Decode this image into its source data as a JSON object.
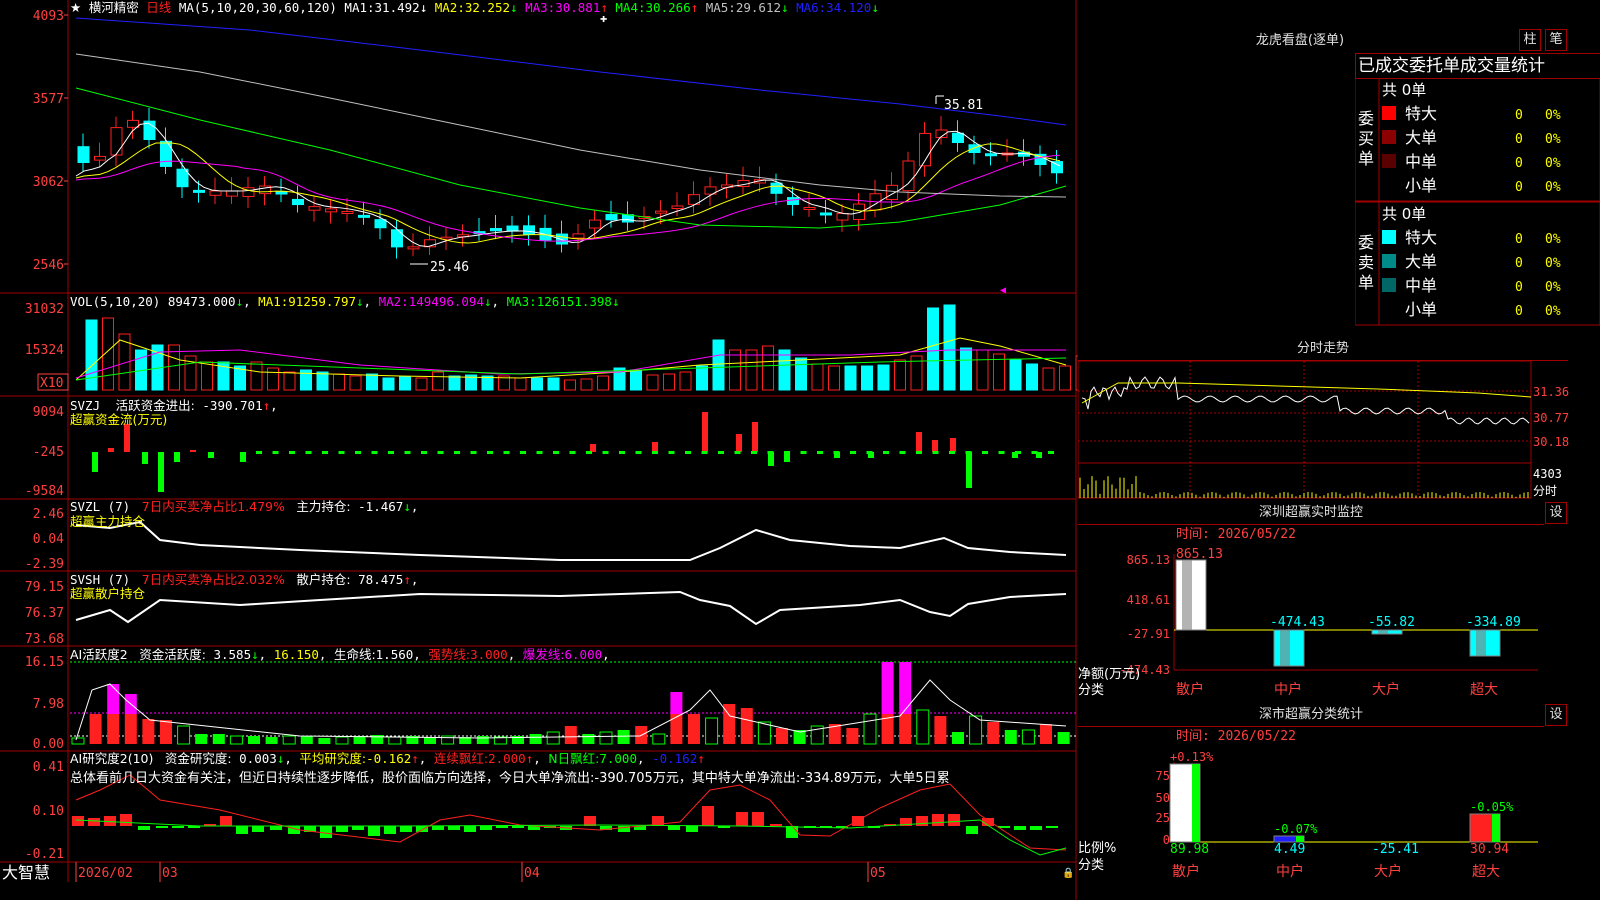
{
  "app_name": "大智慧",
  "stock": {
    "name": "横河精密",
    "period": "日线"
  },
  "colors": {
    "up": "#ff2020",
    "down": "#00ffff",
    "ma1": "#ffffff",
    "ma2": "#ffff00",
    "ma3": "#ff00ff",
    "ma4": "#00ff00",
    "ma5": "#c0c0c0",
    "ma6": "#2020ff",
    "grid": "#a00000"
  },
  "candle": {
    "ma_label": "MA(5,10,20,30,60,120)",
    "ma": [
      {
        "name": "MA1:",
        "value": "31.492",
        "arrow": "↓"
      },
      {
        "name": "MA2:",
        "value": "32.252",
        "arrow": "↓"
      },
      {
        "name": "MA3:",
        "value": "30.881",
        "arrow": "↑"
      },
      {
        "name": "MA4:",
        "value": "30.266",
        "arrow": "↑"
      },
      {
        "name": "MA5:",
        "value": "29.612",
        "arrow": "↓"
      },
      {
        "name": "MA6:",
        "value": "34.120",
        "arrow": "↓"
      }
    ],
    "y_ticks": [
      "4093",
      "3577",
      "3062",
      "2546"
    ],
    "high_mark": "35.81",
    "low_mark": "25.46"
  },
  "vol": {
    "label": "VOL(5,10,20)",
    "value": "89473.000",
    "ma": [
      {
        "name": "MA1:",
        "value": "91259.797",
        "arrow": "↓"
      },
      {
        "name": "MA2:",
        "value": "149496.094",
        "arrow": "↓"
      },
      {
        "name": "MA3:",
        "value": "126151.398",
        "arrow": "↓"
      }
    ],
    "y_ticks": [
      "31032",
      "15324"
    ],
    "unit": "X10"
  },
  "svzj": {
    "label": "SVZJ",
    "desc": "活跃资金进出:",
    "value": "-390.701",
    "arrow": "↑",
    "subtitle": "超赢资金流(万元)",
    "y_ticks": [
      "9094",
      "-245",
      "-9584"
    ]
  },
  "svzl": {
    "label": "SVZL (7)",
    "desc": "7日内买卖净占比1.479%",
    "name2": "主力持仓:",
    "value": "-1.467",
    "arrow": "↓",
    "subtitle": "超赢主力持仓",
    "y_ticks": [
      "2.46",
      "0.04",
      "-2.39"
    ]
  },
  "svsh": {
    "label": "SVSH (7)",
    "desc": "7日内买卖净占比2.032%",
    "name2": "散户持仓:",
    "value": "78.475",
    "arrow": "↑",
    "subtitle": "超赢散户持仓",
    "y_ticks": [
      "79.15",
      "76.37",
      "73.68"
    ]
  },
  "ai1": {
    "label": "AI活跃度2",
    "desc": "资金活跃度:",
    "value": "3.585",
    "arrow": "↓",
    "v2": "16.150",
    "life_label": "生命线:",
    "life_value": "1.560",
    "strong_label": "强势线:",
    "strong_value": "3.000",
    "burst_label": "爆发线:",
    "burst_value": "6.000",
    "y_ticks": [
      "16.15",
      "7.98",
      "0.00"
    ]
  },
  "ai2": {
    "label": "AI研究度2(10)",
    "desc": "资金研究度:",
    "value": "0.003",
    "arrow": "↓",
    "avg_label": "平均研究度:",
    "avg_value": "-0.162",
    "avg_arrow": "↑",
    "red_label": "连续飘红:",
    "red_value": "2.000",
    "red_arrow": "↑",
    "n_label": "N日飘红:",
    "n_value": "7.000",
    "last_value": "-0.162",
    "last_arrow": "↑",
    "commentary": "总体看前几日大资金有关注，但近日持续性逐步降低，股价面临方向选择，今日大单净流出:-390.705万元，其中特大单净流出:-334.89万元，大单5日累",
    "y_ticks": [
      "0.41",
      "0.10",
      "-0.21"
    ]
  },
  "dates": [
    "2026/02",
    "03",
    "04",
    "05"
  ],
  "side": {
    "lhb": {
      "title": "龙虎看盘(逐单)",
      "btn_bar": "柱",
      "btn_stroke": "笔",
      "header": "已成交委托单成交量统计",
      "buy_group": "委买单",
      "sell_group": "委卖单",
      "total_label": "共 0单",
      "rows": [
        "特大",
        "大单",
        "中单",
        "小单"
      ],
      "count": "0",
      "pct": "0%"
    },
    "fenshi": {
      "title": "分时走势",
      "y_ticks": [
        "31.36",
        "30.77",
        "30.18"
      ],
      "vol_tick": "4303",
      "vol_label": "分时"
    },
    "monitor": {
      "title": "深圳超赢实时监控",
      "time": "时间: 2026/05/22",
      "y_ticks": [
        "865.13",
        "418.61",
        "-27.91",
        "-474.43"
      ],
      "ylabel": "净额(万元)",
      "xlabel": "分类",
      "cats": [
        "散户",
        "中户",
        "大户",
        "超大"
      ],
      "values": [
        "865.13",
        "-474.43",
        "-55.82",
        "-334.89"
      ]
    },
    "stats": {
      "title": "深市超赢分类统计",
      "time": "时间: 2026/05/22",
      "y_ticks": [
        "75",
        "50",
        "25",
        "0"
      ],
      "ylabel": "比例%",
      "xlabel": "分类",
      "cats": [
        "散户",
        "中户",
        "大户",
        "超大"
      ],
      "top": [
        "+0.13%",
        "-0.07%",
        "",
        "-0.05%"
      ],
      "bottom": [
        "89.98",
        "4.49",
        "-25.41",
        "30.94"
      ]
    },
    "gear": "设"
  }
}
